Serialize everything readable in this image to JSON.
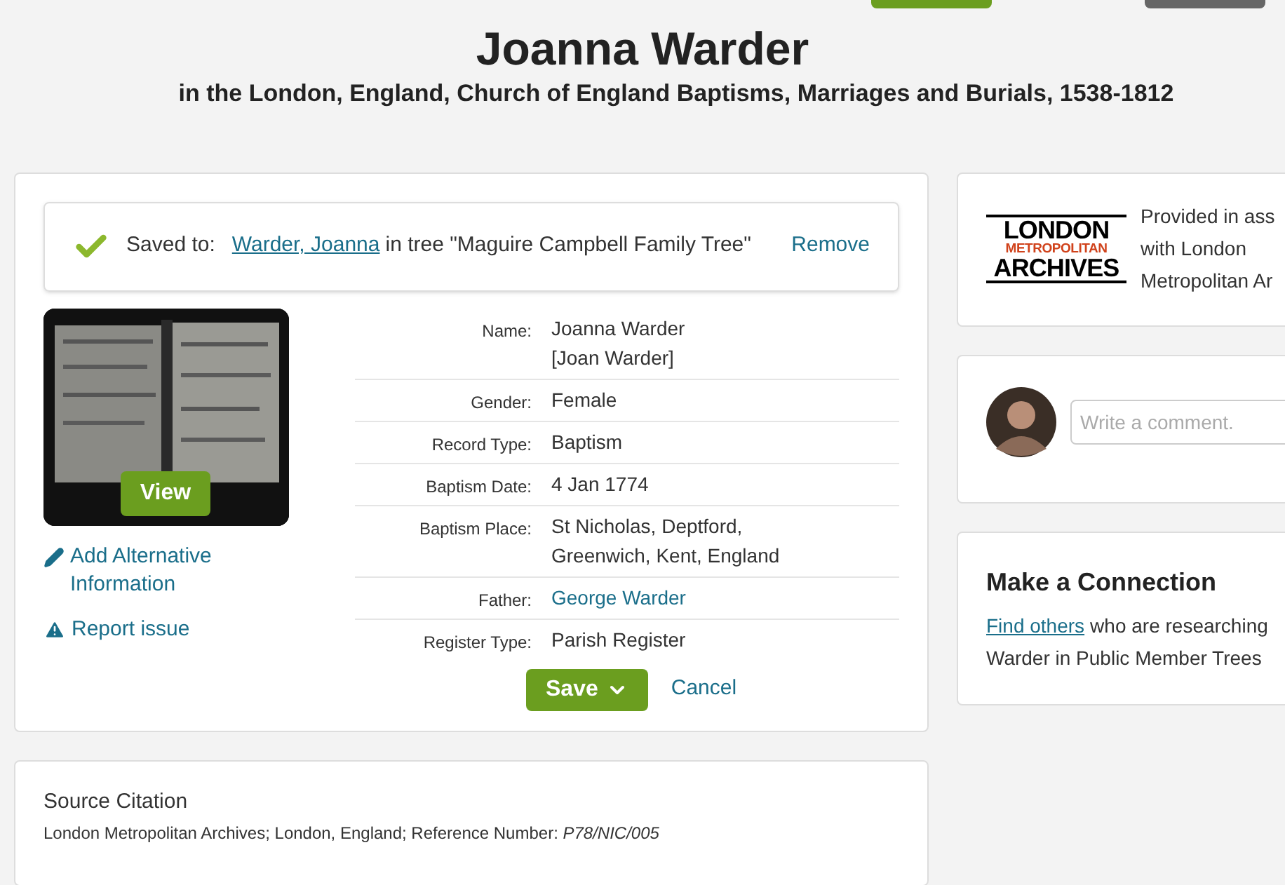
{
  "header": {
    "title": "Joanna Warder",
    "subtitle": "in the London, England, Church of England Baptisms, Marriages and Burials, 1538-1812"
  },
  "saved": {
    "label": "Saved to:",
    "link": "Warder, Joanna",
    "rest": "in tree \"Maguire Campbell Family Tree\"",
    "remove": "Remove"
  },
  "image": {
    "kind": "picture",
    "view": "View"
  },
  "side_links": [
    {
      "kind": "edit",
      "label": "Add Alternative Information"
    },
    {
      "kind": "warning",
      "label": "Report issue"
    }
  ],
  "fields": [
    {
      "label": "Name:",
      "kind": "text",
      "lines": [
        "Joanna Warder",
        "[Joan Warder]"
      ]
    },
    {
      "label": "Gender:",
      "kind": "text",
      "lines": [
        "Female"
      ]
    },
    {
      "label": "Record Type:",
      "kind": "text",
      "lines": [
        "Baptism"
      ]
    },
    {
      "label": "Baptism Date:",
      "kind": "text",
      "lines": [
        "4 Jan 1774"
      ]
    },
    {
      "label": "Baptism Place:",
      "kind": "text",
      "lines": [
        "St Nicholas, Deptford,",
        "Greenwich, Kent, England"
      ]
    },
    {
      "label": "Father:",
      "kind": "link",
      "lines": [
        "George Warder"
      ]
    },
    {
      "label": "Register Type:",
      "kind": "text",
      "lines": [
        "Parish Register"
      ]
    }
  ],
  "actions": {
    "save": "Save",
    "cancel": "Cancel"
  },
  "citation": {
    "title": "Source Citation",
    "text": "London Metropolitan Archives; London, England; Reference Number: *P78/NIC/005*"
  },
  "provider": {
    "logo": [
      "LONDON",
      "METROPOLITAN",
      "ARCHIVES"
    ],
    "lines": [
      "Provided in ass",
      "with London",
      "Metropolitan Ar"
    ]
  },
  "comment": {
    "placeholder": "Write a comment."
  },
  "connection": {
    "title": "Make a Connection",
    "link": "Find others",
    "rest": "who are researching",
    "line2": "Warder in Public Member Trees"
  }
}
